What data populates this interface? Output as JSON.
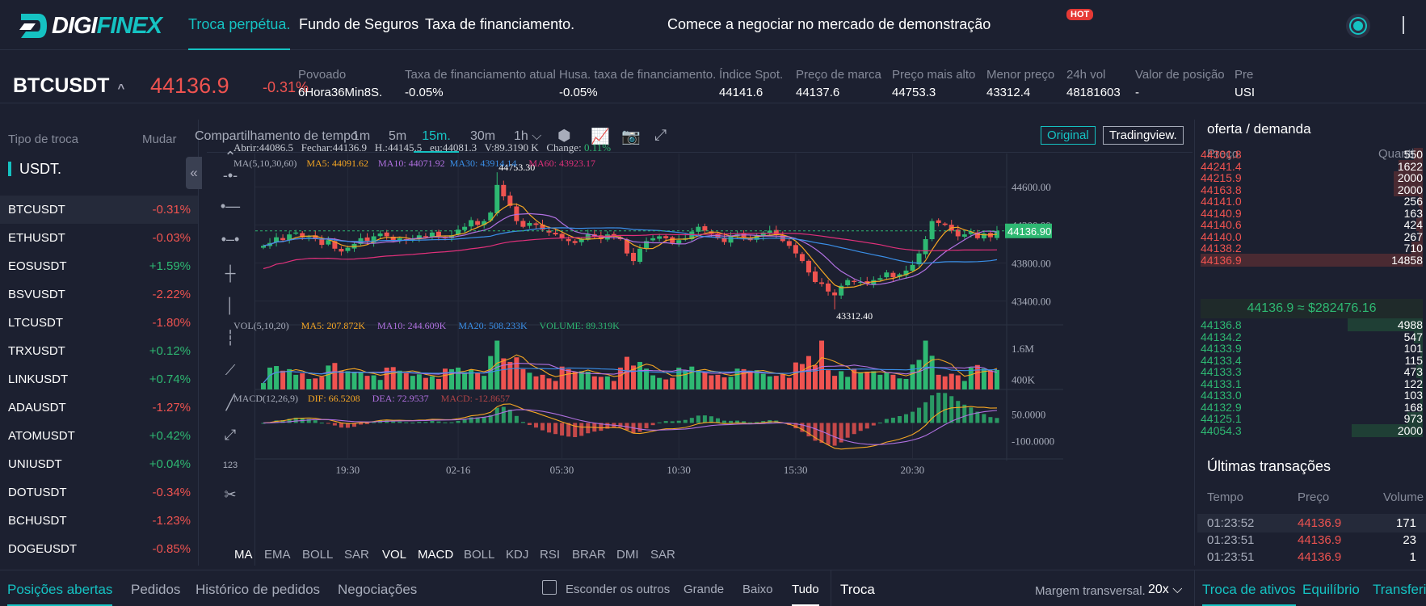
{
  "brand": {
    "name_a": "DIGI",
    "name_b": "FINEX"
  },
  "nav": {
    "perp": "Troca perpétua.",
    "insurance": "Fundo de Seguros",
    "funding": "Taxa de financiamento.",
    "demo": "Comece a negociar no mercado de demonstração",
    "hot": "HOT"
  },
  "ticker": {
    "symbol": "BTCUSDT",
    "last_price": "44136.9",
    "change": "-0.31%",
    "stats": [
      {
        "label": "Povoado",
        "value": "6Hora36Min8S."
      },
      {
        "label": "Taxa de financiamento atual",
        "value": "-0.05%"
      },
      {
        "label": "Husa. taxa de financiamento.",
        "value": "-0.05%"
      },
      {
        "label": "Índice Spot.",
        "value": "44141.6"
      },
      {
        "label": "Preço de marca",
        "value": "44137.6"
      },
      {
        "label": "Preço mais alto",
        "value": "44753.3"
      },
      {
        "label": "Menor preço",
        "value": "43312.4"
      },
      {
        "label": "24h vol",
        "value": "48181603"
      },
      {
        "label": "Valor de posição",
        "value": "-"
      },
      {
        "label": "Pre",
        "value": "USI"
      }
    ]
  },
  "markets": {
    "type_label": "Tipo de troca",
    "change_label": "Mudar",
    "quote": "USDT.",
    "collapse": "«",
    "pairs": [
      {
        "name": "BTCUSDT",
        "change": "-0.31%",
        "dir": "neg"
      },
      {
        "name": "ETHUSDT",
        "change": "-0.03%",
        "dir": "neg"
      },
      {
        "name": "EOSUSDT",
        "change": "+1.59%",
        "dir": "pos"
      },
      {
        "name": "BSVUSDT",
        "change": "-2.22%",
        "dir": "neg"
      },
      {
        "name": "LTCUSDT",
        "change": "-1.80%",
        "dir": "neg"
      },
      {
        "name": "TRXUSDT",
        "change": "+0.12%",
        "dir": "pos"
      },
      {
        "name": "LINKUSDT",
        "change": "+0.74%",
        "dir": "pos"
      },
      {
        "name": "ADAUSDT",
        "change": "-1.27%",
        "dir": "neg"
      },
      {
        "name": "ATOMUSDT",
        "change": "+0.42%",
        "dir": "pos"
      },
      {
        "name": "UNIUSDT",
        "change": "+0.04%",
        "dir": "pos"
      },
      {
        "name": "DOTUSDT",
        "change": "-0.34%",
        "dir": "neg"
      },
      {
        "name": "BCHUSDT",
        "change": "-1.23%",
        "dir": "neg"
      },
      {
        "name": "DOGEUSDT",
        "change": "-0.85%",
        "dir": "neg"
      }
    ]
  },
  "chart_toolbar": {
    "timeshare": "Compartilhamento de tempo",
    "tf_1m": "1m",
    "tf_5m": "5m",
    "tf_15m": "15m.",
    "tf_30m": "30m",
    "tf_1h": "1h",
    "tf_1h_chev": "⌵",
    "original": "Original",
    "tradingview": "Tradingview."
  },
  "chart_data": {
    "type": "candlestick",
    "interval": "15m",
    "info": {
      "open_label": "Abrir:",
      "open": "44086.5",
      "close_label": "Fechar:",
      "close": "44136.9",
      "high_label": "H.:",
      "high": "44145.5",
      "low_label": "eu:",
      "low": "44081.3",
      "vol_label": "V:",
      "vol": "89.3190 K",
      "chg_label": "Change:",
      "chg": "0.11%"
    },
    "ma_legend": {
      "label": "MA(5,10,30,60)",
      "ma5": "MA5: 44091.62",
      "ma10": "MA10: 44071.92",
      "ma30": "MA30: 43914.14",
      "ma60": "MA60: 43923.17"
    },
    "vol_legend": {
      "label": "VOL(5,10,20)",
      "ma5": "MA5: 207.872K",
      "ma10": "MA10: 244.609K",
      "ma20": "MA20: 508.233K",
      "volume": "VOLUME: 89.319K"
    },
    "macd_legend": {
      "label": "MACD(12,26,9)",
      "dif": "DIF: 66.5208",
      "dea": "DEA: 72.9537",
      "macd": "MACD: -12.8657"
    },
    "price_axis": {
      "ticks": [
        "44600.00",
        "44200.00",
        "43800.00",
        "43400.00"
      ],
      "tick_values": [
        44600,
        44200,
        43800,
        43400
      ],
      "ylim": [
        43150,
        44950
      ]
    },
    "vol_axis": {
      "ticks": [
        "1.6M",
        "400K"
      ],
      "tick_values": [
        1600000,
        400000
      ],
      "ylim": [
        0,
        2200000
      ]
    },
    "macd_axis": {
      "ticks": [
        "50.0000",
        "-100.0000"
      ],
      "tick_values": [
        50,
        -100
      ],
      "ylim": [
        -200,
        150
      ]
    },
    "x_ticks": [
      "19:30",
      "02-16",
      "05:30",
      "10:30",
      "15:30",
      "20:30"
    ],
    "x_tick_index": [
      13,
      30,
      46,
      64,
      82,
      100
    ],
    "high_marker": "44753.30",
    "high_index": 36,
    "low_marker": "43312.40",
    "low_index": 88,
    "last_price_label": "44136.90",
    "last_price": 44136.9,
    "colors": {
      "up": "#2eb872",
      "down": "#ef5350",
      "ma5": "#f5a623",
      "ma10": "#b070e0",
      "ma30": "#3a8fe8",
      "ma60": "#e0307a"
    },
    "close": [
      43980,
      44010,
      44070,
      44040,
      44100,
      44120,
      44070,
      44080,
      44050,
      43990,
      44040,
      43950,
      43920,
      43960,
      44000,
      44060,
      44020,
      44080,
      44110,
      44080,
      44030,
      44060,
      44040,
      44050,
      44090,
      44070,
      44120,
      44080,
      44060,
      44090,
      44150,
      44180,
      44250,
      44200,
      44240,
      44330,
      44620,
      44500,
      44400,
      44240,
      44180,
      44220,
      44200,
      44150,
      44120,
      44100,
      44060,
      44030,
      44010,
      44050,
      44100,
      44080,
      44050,
      44100,
      44080,
      44050,
      43900,
      43820,
      43950,
      44030,
      44060,
      44080,
      44060,
      44010,
      44040,
      44060,
      44130,
      44180,
      44140,
      44110,
      44060,
      44020,
      44080,
      44100,
      44070,
      44040,
      44090,
      44120,
      44140,
      44100,
      44030,
      43980,
      43900,
      43820,
      43700,
      43600,
      43580,
      43500,
      43460,
      43560,
      43620,
      43600,
      43600,
      43580,
      43620,
      43640,
      43700,
      43650,
      43680,
      43720,
      43780,
      43900,
      44050,
      44240,
      44220,
      44200,
      44140,
      44080,
      44100,
      44130,
      44060,
      44110,
      44070,
      44137
    ]
  },
  "indicators": [
    "MA",
    "EMA",
    "BOLL",
    "SAR",
    "VOL",
    "MACD",
    "BOLL",
    "KDJ",
    "RSI",
    "BRAR",
    "DMI",
    "SAR"
  ],
  "orderbook": {
    "title": "oferta / demanda",
    "price_h": "Preço",
    "qty_h": "Quantia",
    "asks": [
      {
        "p": "44301.8",
        "q": "550",
        "d": 0.04
      },
      {
        "p": "44241.4",
        "q": "1622",
        "d": 0.11
      },
      {
        "p": "44215.9",
        "q": "2000",
        "d": 0.13
      },
      {
        "p": "44163.8",
        "q": "2000",
        "d": 0.13
      },
      {
        "p": "44141.0",
        "q": "256",
        "d": 0.02
      },
      {
        "p": "44140.9",
        "q": "163",
        "d": 0.01
      },
      {
        "p": "44140.6",
        "q": "424",
        "d": 0.03
      },
      {
        "p": "44140.0",
        "q": "267",
        "d": 0.02
      },
      {
        "p": "44138.2",
        "q": "710",
        "d": 0.05
      },
      {
        "p": "44136.9",
        "q": "14858",
        "d": 1.0
      }
    ],
    "mid": "44136.9 ≈ $282476.16",
    "bids": [
      {
        "p": "44136.8",
        "q": "4988",
        "d": 0.34
      },
      {
        "p": "44134.2",
        "q": "547",
        "d": 0.04
      },
      {
        "p": "44133.9",
        "q": "101",
        "d": 0.01
      },
      {
        "p": "44133.4",
        "q": "115",
        "d": 0.01
      },
      {
        "p": "44133.3",
        "q": "473",
        "d": 0.03
      },
      {
        "p": "44133.1",
        "q": "122",
        "d": 0.01
      },
      {
        "p": "44133.0",
        "q": "103",
        "d": 0.01
      },
      {
        "p": "44132.9",
        "q": "168",
        "d": 0.01
      },
      {
        "p": "44125.1",
        "q": "973",
        "d": 0.07
      },
      {
        "p": "44054.3",
        "q": "2000",
        "d": 0.32
      }
    ]
  },
  "trades": {
    "title": "Últimas transações",
    "time_h": "Tempo",
    "price_h": "Preço",
    "vol_h": "Volume",
    "rows": [
      {
        "t": "01:23:52",
        "p": "44136.9",
        "v": "171"
      },
      {
        "t": "01:23:51",
        "p": "44136.9",
        "v": "23"
      },
      {
        "t": "01:23:51",
        "p": "44136.9",
        "v": "1"
      }
    ]
  },
  "bottom": {
    "open_pos": "Posições abertas",
    "orders": "Pedidos",
    "history": "Histórico de pedidos",
    "trades": "Negociações",
    "hide": "Esconder os outros",
    "big": "Grande",
    "low": "Baixo",
    "all": "Tudo",
    "troca": "Troca",
    "margin": "Margem transversal.",
    "margin_val": "20x",
    "asset": "Troca de ativos",
    "balance": "Equilíbrio",
    "transfer": "Transferir"
  }
}
